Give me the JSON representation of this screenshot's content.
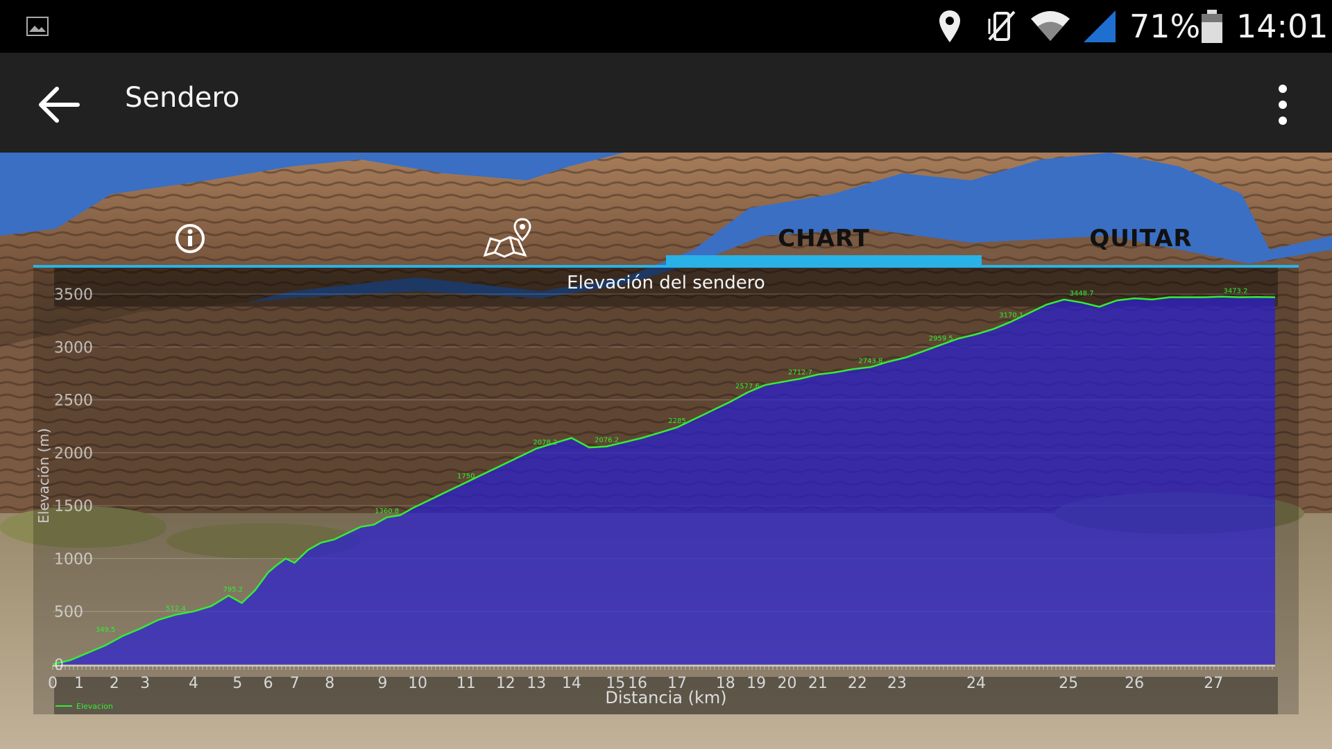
{
  "status_bar": {
    "battery_percent": "71%",
    "time": "14:01",
    "icons": [
      "image-icon",
      "location-icon",
      "vibrate-off-icon",
      "wifi-icon",
      "signal-icon",
      "battery-icon"
    ]
  },
  "app_bar": {
    "title": "Sendero",
    "back_icon": "arrow-back-icon",
    "menu_icon": "more-vert-icon"
  },
  "tabs": [
    {
      "type": "icon",
      "icon": "info-icon"
    },
    {
      "type": "icon",
      "icon": "map-pin-icon"
    },
    {
      "type": "text",
      "label": "CHART",
      "selected": true
    },
    {
      "type": "text",
      "label": "QUITAR"
    }
  ],
  "colors": {
    "accent": "#29b2e6",
    "series_line": "#33ee33",
    "series_fill": "#2a20d0",
    "appbar": "#212121"
  },
  "chart_data": {
    "type": "area",
    "title": "Elevación del sendero",
    "xlabel": "Distancia (km)",
    "ylabel": "Elevación (m)",
    "xlim": [
      0,
      27.8
    ],
    "ylim": [
      0,
      3500
    ],
    "grid": true,
    "legend": "bottom-left",
    "x_ticks": [
      "0",
      "1",
      "2",
      "3",
      "4",
      "5",
      "6",
      "7",
      "8",
      "9",
      "10",
      "11",
      "12",
      "13",
      "14",
      "15",
      "16",
      "17",
      "18",
      "19",
      "20",
      "21",
      "22",
      "23",
      "24",
      "25",
      "26",
      "27"
    ],
    "x_tick_values": [
      0,
      0.6,
      1.4,
      2.1,
      3.2,
      4.2,
      4.9,
      5.5,
      6.3,
      7.5,
      8.3,
      9.4,
      10.3,
      11.0,
      11.8,
      12.8,
      13.3,
      14.2,
      15.3,
      16.0,
      16.7,
      17.4,
      18.3,
      19.2,
      21.0,
      23.1,
      24.6,
      26.4
    ],
    "y_ticks": [
      0,
      500,
      1000,
      1500,
      2000,
      2500,
      3000,
      3500
    ],
    "series": [
      {
        "name": "Elevacion",
        "x": [
          0,
          0.4,
          0.8,
          1.2,
          1.6,
          2.0,
          2.4,
          2.8,
          3.2,
          3.6,
          4.0,
          4.3,
          4.6,
          4.9,
          5.1,
          5.3,
          5.5,
          5.8,
          6.1,
          6.4,
          6.7,
          7.0,
          7.3,
          7.6,
          7.9,
          8.2,
          8.6,
          9.0,
          9.4,
          9.8,
          10.2,
          10.6,
          11.0,
          11.4,
          11.8,
          12.2,
          12.6,
          13.0,
          13.4,
          13.8,
          14.2,
          14.6,
          15.0,
          15.4,
          15.8,
          16.2,
          16.6,
          17.0,
          17.4,
          17.8,
          18.2,
          18.6,
          19.0,
          19.4,
          19.8,
          20.2,
          20.6,
          21.0,
          21.4,
          21.8,
          22.2,
          22.6,
          23.0,
          23.4,
          23.8,
          24.2,
          24.6,
          25.0,
          25.4,
          25.8,
          26.2,
          26.6,
          27.0,
          27.4,
          27.8
        ],
        "y": [
          0,
          40,
          110,
          180,
          270,
          340,
          420,
          470,
          500,
          550,
          650,
          580,
          700,
          870,
          940,
          1000,
          960,
          1080,
          1150,
          1180,
          1240,
          1300,
          1320,
          1390,
          1410,
          1480,
          1560,
          1640,
          1720,
          1800,
          1880,
          1960,
          2040,
          2090,
          2140,
          2050,
          2060,
          2100,
          2140,
          2190,
          2240,
          2320,
          2400,
          2480,
          2570,
          2640,
          2670,
          2700,
          2740,
          2760,
          2790,
          2810,
          2860,
          2900,
          2960,
          3020,
          3080,
          3120,
          3170,
          3240,
          3320,
          3400,
          3448,
          3420,
          3380,
          3440,
          3460,
          3448,
          3470,
          3470,
          3470,
          3475,
          3470,
          3472,
          3470
        ],
        "labels": [
          {
            "x": 1.2,
            "y": 270,
            "text": "349.5"
          },
          {
            "x": 2.8,
            "y": 470,
            "text": "512.4"
          },
          {
            "x": 4.1,
            "y": 650,
            "text": "795.2"
          },
          {
            "x": 7.6,
            "y": 1390,
            "text": "1360.8"
          },
          {
            "x": 9.4,
            "y": 1720,
            "text": "1750"
          },
          {
            "x": 11.2,
            "y": 2040,
            "text": "2078.2"
          },
          {
            "x": 12.6,
            "y": 2060,
            "text": "2076.2"
          },
          {
            "x": 14.2,
            "y": 2240,
            "text": "2285"
          },
          {
            "x": 15.8,
            "y": 2570,
            "text": "2577.6"
          },
          {
            "x": 17.0,
            "y": 2700,
            "text": "2712.7"
          },
          {
            "x": 18.6,
            "y": 2810,
            "text": "2743.8"
          },
          {
            "x": 20.2,
            "y": 3020,
            "text": "2959.5"
          },
          {
            "x": 21.8,
            "y": 3240,
            "text": "3170.1"
          },
          {
            "x": 23.4,
            "y": 3448,
            "text": "3448.7"
          },
          {
            "x": 26.9,
            "y": 3472,
            "text": "3473.2"
          }
        ]
      }
    ]
  }
}
